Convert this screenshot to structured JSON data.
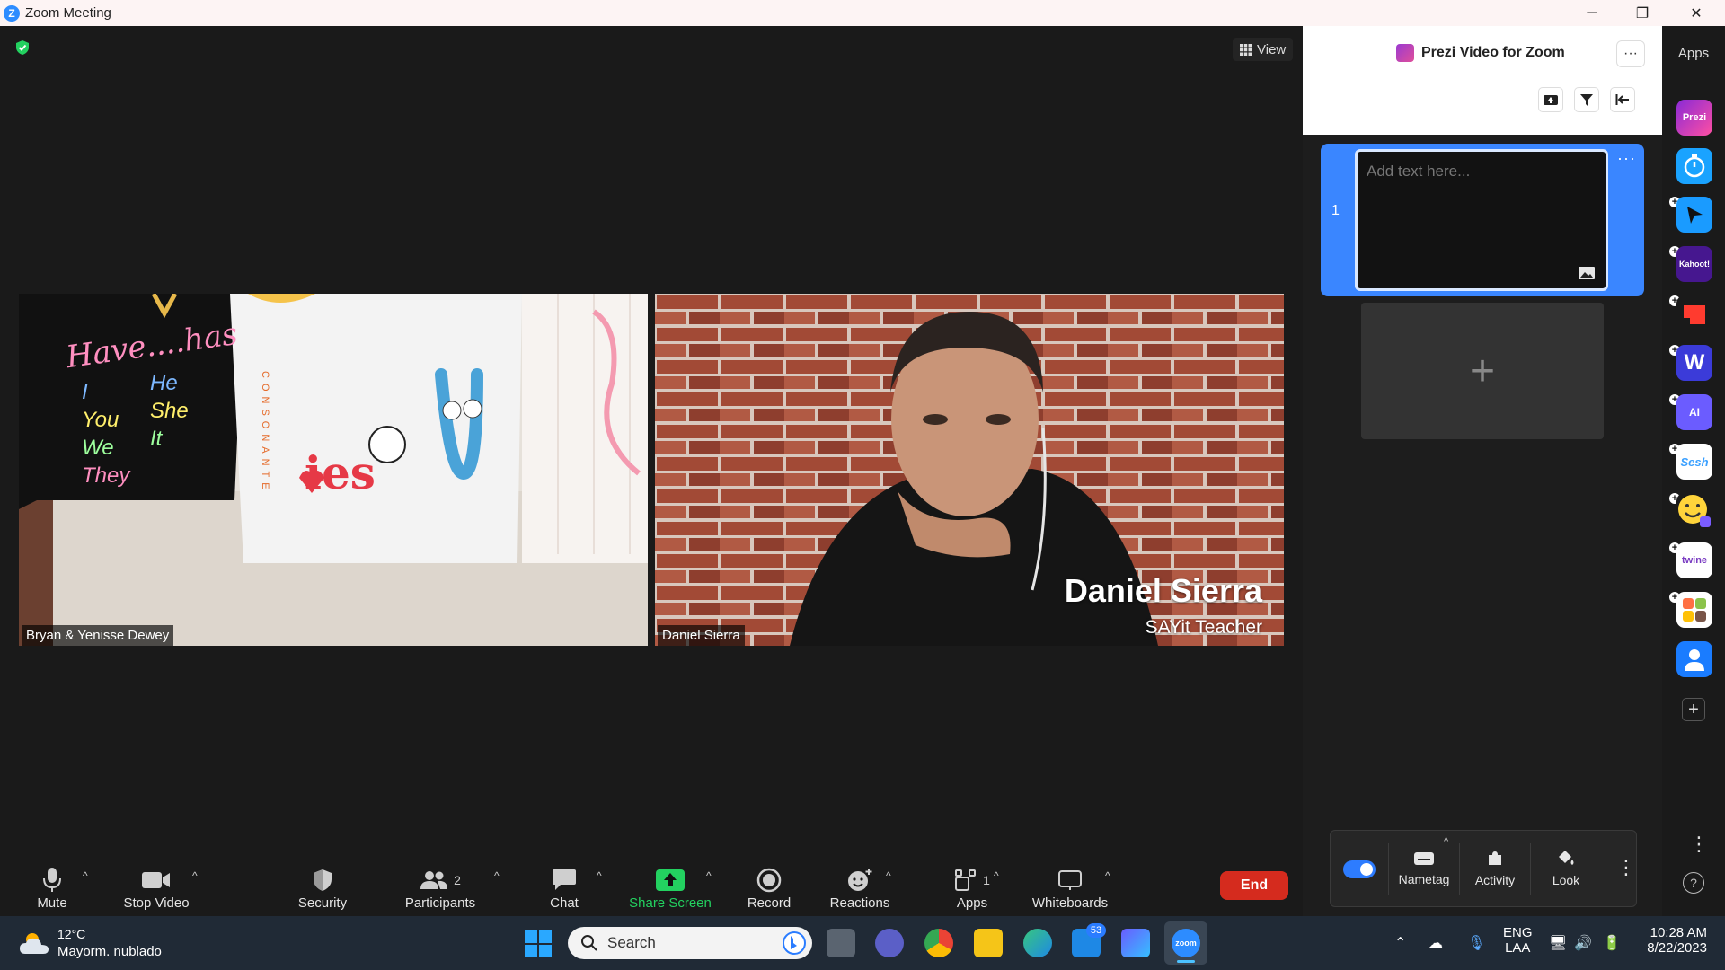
{
  "window": {
    "title": "Zoom Meeting",
    "minimize": "─",
    "restore": "❐",
    "close": "✕"
  },
  "meeting": {
    "view_label": "View",
    "tiles": [
      {
        "name": "Bryan & Yenisse Dewey"
      },
      {
        "name": "Daniel Sierra",
        "overlay_name": "Daniel Sierra",
        "overlay_subtitle": "SAYit Teacher"
      }
    ],
    "classroom_text": {
      "title": "Have....has",
      "pronouns_left": [
        "I",
        "You",
        "We",
        "They"
      ],
      "pronouns_right": [
        "He",
        "She",
        "It"
      ],
      "ies": "ies",
      "vertical": "CONSONANTE"
    }
  },
  "toolbar": {
    "mute": "Mute",
    "stop_video": "Stop Video",
    "security": "Security",
    "participants": "Participants",
    "participants_count": "2",
    "chat": "Chat",
    "share_screen": "Share Screen",
    "record": "Record",
    "reactions": "Reactions",
    "apps": "Apps",
    "apps_count": "1",
    "whiteboards": "Whiteboards",
    "end": "End"
  },
  "panel": {
    "title": "Prezi Video for Zoom",
    "more": "···",
    "slide_number": "1",
    "slide_placeholder": "Add text here...",
    "slide_more": "···",
    "add_slide": "+",
    "footer": {
      "nametag": "Nametag",
      "activity": "Activity",
      "look": "Look",
      "more": "⋮"
    }
  },
  "rail": {
    "title": "Apps",
    "apps": [
      {
        "name": "prezi",
        "label": "Prezi",
        "color": "#c23bd6"
      },
      {
        "name": "timer",
        "label": "",
        "color": "#1aa3ff"
      },
      {
        "name": "pointer-app",
        "label": "",
        "color": "#1a9bff"
      },
      {
        "name": "kahoot",
        "label": "Kahoot!",
        "color": "#46178f"
      },
      {
        "name": "red-app",
        "label": "",
        "color": "#ffffff"
      },
      {
        "name": "wooclap",
        "label": "W",
        "color": "#3b3bd9"
      },
      {
        "name": "ai-app",
        "label": "AI",
        "color": "#6b5cff"
      },
      {
        "name": "sesh",
        "label": "Sesh",
        "color": "#ffffff"
      },
      {
        "name": "emoji-app",
        "label": "",
        "color": "#ffd43b"
      },
      {
        "name": "twine",
        "label": "twine",
        "color": "#ffffff"
      },
      {
        "name": "grid-app",
        "label": "",
        "color": "#ffffff"
      },
      {
        "name": "avatar-app",
        "label": "",
        "color": "#1a7cff"
      }
    ],
    "add": "+",
    "more": "⋮",
    "help": "?"
  },
  "taskbar": {
    "weather_temp": "12°C",
    "weather_desc": "Mayorm. nublado",
    "search": "Search",
    "mail_badge": "53",
    "lang": "ENG",
    "lang_sub": "LAA",
    "time": "10:28 AM",
    "date": "8/22/2023"
  }
}
